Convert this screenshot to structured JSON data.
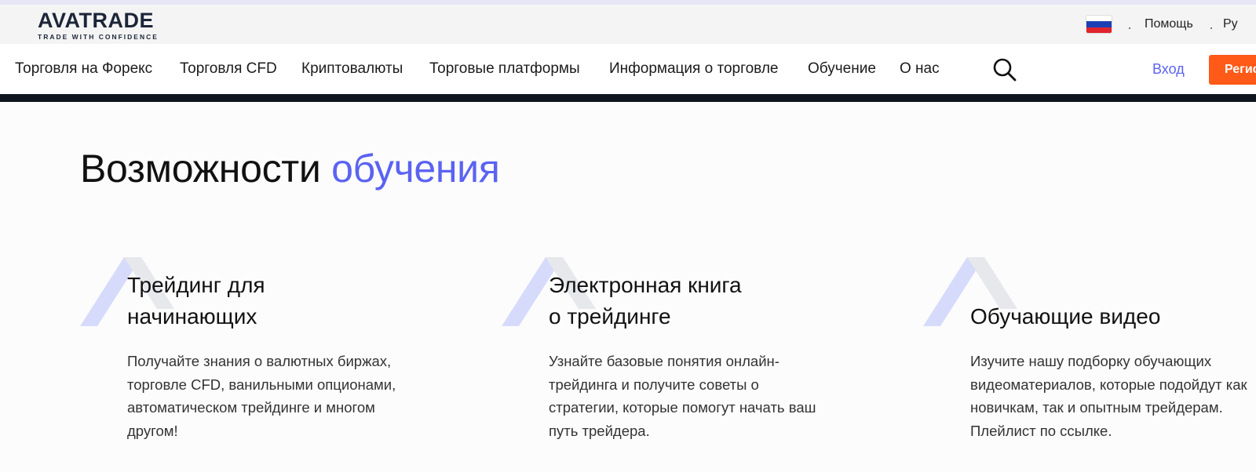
{
  "topbar": {
    "logo_word": "AVATRADE",
    "logo_tagline": "TRADE WITH CONFIDENCE",
    "help_label": "Помощь",
    "language_label": "Ру"
  },
  "nav": {
    "items": [
      "Торговля на Форекс",
      "Торговля CFD",
      "Криптовалюты",
      "Торговые платформы",
      "Информация о торговле",
      "Обучение",
      "О нас"
    ],
    "login_label": "Вход",
    "register_label": "Регистрация"
  },
  "section": {
    "title_plain": "Возможности",
    "title_accent": "обучения"
  },
  "cards": [
    {
      "title_line1": "Трейдинг для",
      "title_line2": "начинающих",
      "text": "Получайте знания о валютных биржах, торговле CFD, ванильными опционами, автоматическом трейдинге и многом другом!"
    },
    {
      "title_line1": "Электронная книга",
      "title_line2": "о трейдинге",
      "text": "Узнайте базовые понятия онлайн-трейдинга и получите советы о стратегии, которые помогут начать ваш путь трейдера."
    },
    {
      "title_line1": "",
      "title_line2": "Обучающие видео",
      "text": "Изучите нашу подборку обучающих видеоматериалов, которые подойдут как новичкам, так и опытным трейдерам. Плейлист по ссылке."
    }
  ],
  "colors": {
    "accent": "#5a63f2",
    "register": "#ff5a17",
    "nav_underline": "#10141c",
    "card_mark_light": "#d7dbfb",
    "card_mark_gray": "#e6e8ec"
  },
  "icons": {
    "flag": "russia-flag-icon",
    "search": "search-icon",
    "card_mark": "avatrade-a-mark-icon"
  }
}
